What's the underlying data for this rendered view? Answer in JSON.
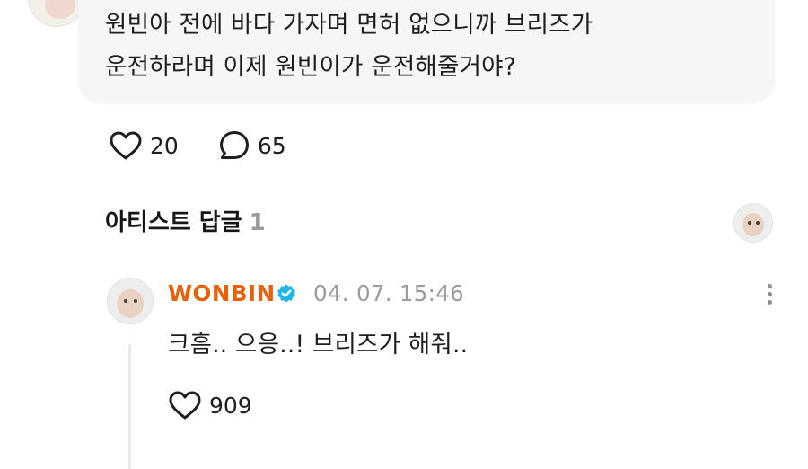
{
  "post": {
    "text_lines": [
      "원빈아 전에 바다 가자며 면허 없으니까 브리즈가",
      "운전하라며 이제 원빈이가 운전해줄거야?"
    ],
    "likes": "20",
    "comments": "65",
    "like_icon": "heart-outline-icon",
    "comment_icon": "speech-bubble-icon"
  },
  "artist_section": {
    "title": "아티스트 답글",
    "count": "1"
  },
  "reply": {
    "author": "WONBIN",
    "verified_icon": "verified-badge-icon",
    "timestamp": "04. 07. 15:46",
    "text": "크흠.. 으응..! 브리즈가 해줘..",
    "likes": "909",
    "more_icon": "more-vertical-icon"
  },
  "colors": {
    "author_name": "#e8620c",
    "verified_badge": "#1fb5e6",
    "muted": "#9a9a9f",
    "bubble_bg": "#f6f6f8"
  }
}
